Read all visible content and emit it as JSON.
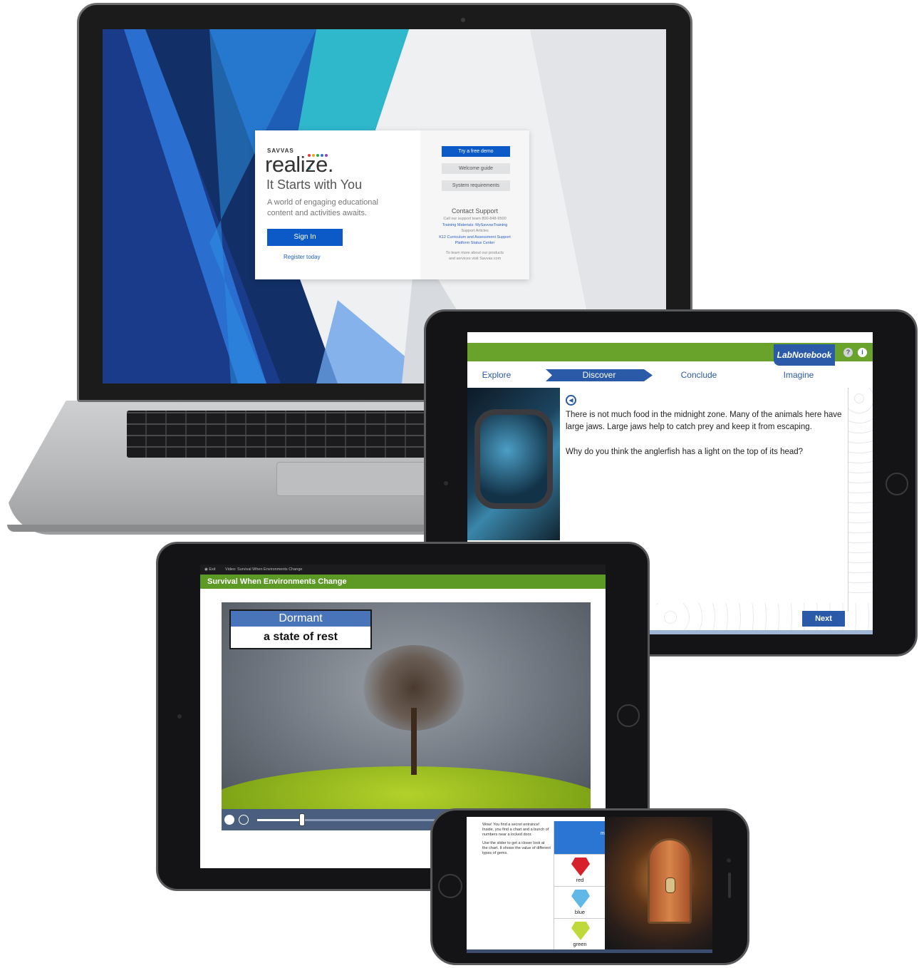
{
  "laptop": {
    "brand_small": "SAVVAS",
    "brand_large": "realize.",
    "heading": "It Starts with You",
    "tagline": "A world of engaging educational content and activities awaits.",
    "sign_in": "Sign In",
    "register": "Register today",
    "free_demo": "Try a free demo",
    "welcome_guide": "Welcome guide",
    "system_requirements": "System requirements",
    "contact_title": "Contact Support",
    "contact_lines": [
      "Call our support team 800-848-9500",
      "Training Materials: MySavvasTraining",
      "Support Articles",
      "K12 Curriculum and Assessment Support",
      "Platform Status Center"
    ],
    "footer_lines": [
      "To learn more about our products",
      "and services visit Savvas.com"
    ],
    "dot_colors": [
      "#e03b3b",
      "#f2a51c",
      "#2aa84a",
      "#2f6fd6",
      "#8b44c2",
      "#1bb3c8"
    ]
  },
  "lab_notebook": {
    "title": "LabNotebook",
    "steps": [
      "Explore",
      "Discover",
      "Conclude",
      "Imagine"
    ],
    "active_step": "Discover",
    "passage": "There is not much food in the midnight zone. Many of the animals here have large jaws. Large jaws help to catch prey and keep it from escaping.",
    "question": "Why do you think the anglerfish has a light on the top of its head?",
    "next_label": "Next",
    "help_icon": "?",
    "info_icon": "i"
  },
  "video_lesson": {
    "top_exit": "Exit",
    "top_title": "Video: Survival When Environments Change",
    "bar_title": "Survival When Environments Change",
    "term": "Dormant",
    "definition": "a state of rest",
    "progress": 0.25
  },
  "phone_activity": {
    "intro": "Wow! You find a secret entrance! Inside, you find a chart and a bunch of numbers near a locked door.",
    "instruction": "Use the slider to get a closer look at the chart. It shows the value of different types of gems.",
    "header_letter": "m",
    "gems": [
      {
        "label": "red",
        "color": "#d8222b"
      },
      {
        "label": "blue",
        "color": "#5fb8e6"
      },
      {
        "label": "green",
        "color": "#bfd83a"
      }
    ]
  }
}
